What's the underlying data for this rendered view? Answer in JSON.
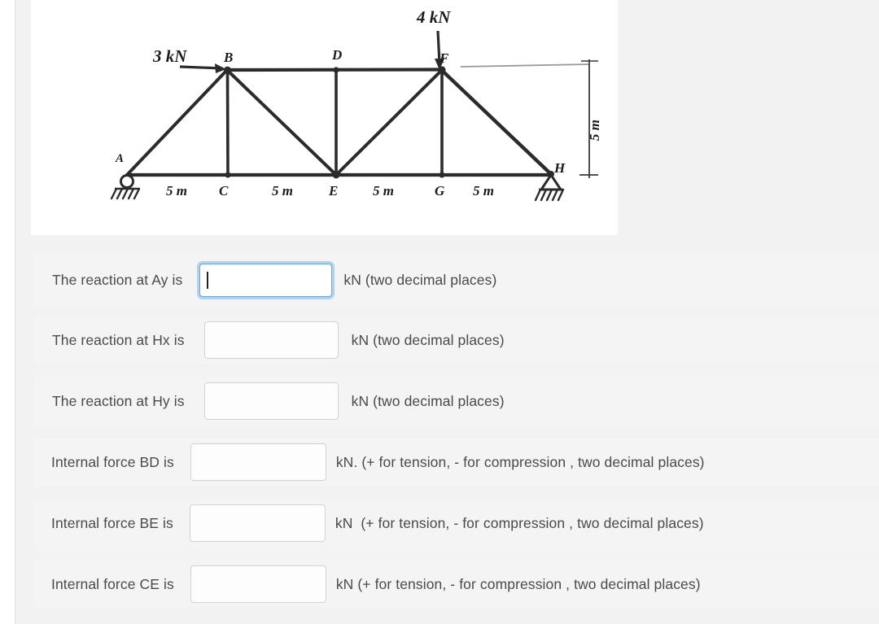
{
  "figure": {
    "alt_title": "Plane truss free-body diagram",
    "loads": [
      {
        "name": "load-3kn",
        "label": "3 kN",
        "applied_at": "B",
        "direction": "horizontal-right",
        "magnitude": 3,
        "unit": "kN"
      },
      {
        "name": "load-4kn",
        "label": "4 kN",
        "applied_at": "F",
        "direction": "vertical-down",
        "magnitude": 4,
        "unit": "kN"
      }
    ],
    "joint_labels": [
      "A",
      "B",
      "C",
      "D",
      "E",
      "F",
      "G",
      "H"
    ],
    "span_labels": [
      "5 m",
      "5 m",
      "5 m",
      "5 m"
    ],
    "height_label": "5 m",
    "supports": [
      {
        "joint": "A",
        "type": "roller"
      },
      {
        "joint": "H",
        "type": "pin"
      }
    ],
    "members": [
      "AB",
      "AC",
      "BC",
      "BD",
      "BE",
      "CE",
      "DE",
      "DF",
      "EF",
      "EG",
      "FG",
      "FH",
      "GH"
    ],
    "ink_color": "#2b2b2b"
  },
  "questions": [
    {
      "id": "reaction-ay",
      "label": "The reaction at Ay is",
      "value": "",
      "placeholder": "",
      "units": "kN (two decimal places)",
      "focused": true
    },
    {
      "id": "reaction-hx",
      "label": "The reaction at Hx is",
      "value": "",
      "placeholder": "",
      "units": "kN (two decimal places)",
      "focused": false
    },
    {
      "id": "reaction-hy",
      "label": "The reaction at Hy is",
      "value": "",
      "placeholder": "",
      "units": "kN (two decimal places)",
      "focused": false
    },
    {
      "id": "internal-force-bd",
      "label": "Internal force BD is",
      "value": "",
      "placeholder": "",
      "units": "kN. (+ for tension, - for compression , two decimal places)",
      "focused": false
    },
    {
      "id": "internal-force-be",
      "label": "Internal force BE is",
      "value": "",
      "placeholder": "",
      "units": "kN  (+ for tension, - for compression , two decimal places)",
      "focused": false
    },
    {
      "id": "internal-force-ce",
      "label": "Internal force CE is",
      "value": "",
      "placeholder": "",
      "units": "kN (+ for tension, - for compression , two decimal places)",
      "focused": false
    }
  ],
  "colors": {
    "page_background": "#f2f2f2",
    "row_background": "#f4f4f4",
    "figure_background": "#ffffff",
    "focus_ring": "#69a8e0",
    "text": "#4a4a4a"
  }
}
